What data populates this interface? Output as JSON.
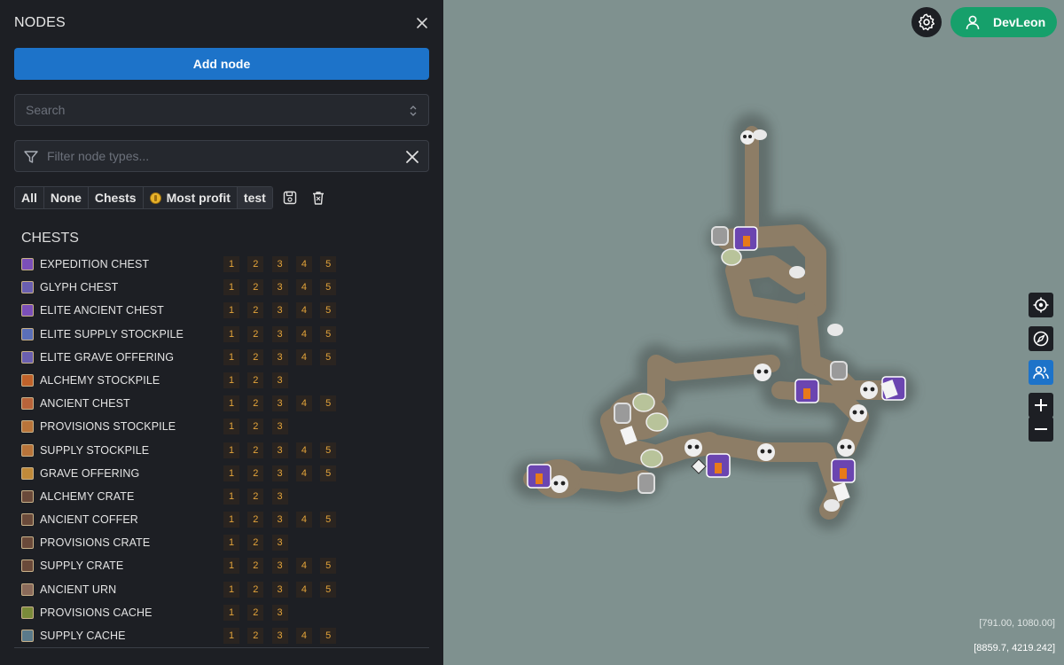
{
  "sidebar": {
    "title": "NODES",
    "add_button": "Add node",
    "search_placeholder": "Search",
    "filter_placeholder": "Filter node types...",
    "presets": [
      {
        "label": "All"
      },
      {
        "label": "None"
      },
      {
        "label": "Chests"
      },
      {
        "label": "Most profit",
        "icon": "coin-icon"
      },
      {
        "label": "test"
      }
    ],
    "tool_icons": [
      "save-preset-icon",
      "delete-preset-icon"
    ],
    "section_title": "CHESTS",
    "items": [
      {
        "label": "EXPEDITION CHEST",
        "tiers": [
          "1",
          "2",
          "3",
          "4",
          "5"
        ],
        "color": "#7b4fb8"
      },
      {
        "label": "GLYPH CHEST",
        "tiers": [
          "1",
          "2",
          "3",
          "4",
          "5"
        ],
        "color": "#6a5fb0"
      },
      {
        "label": "ELITE ANCIENT CHEST",
        "tiers": [
          "1",
          "2",
          "3",
          "4",
          "5"
        ],
        "color": "#7b4fb8"
      },
      {
        "label": "ELITE SUPPLY STOCKPILE",
        "tiers": [
          "1",
          "2",
          "3",
          "4",
          "5"
        ],
        "color": "#5a6fb8"
      },
      {
        "label": "ELITE GRAVE OFFERING",
        "tiers": [
          "1",
          "2",
          "3",
          "4",
          "5"
        ],
        "color": "#6a5fb0"
      },
      {
        "label": "ALCHEMY STOCKPILE",
        "tiers": [
          "1",
          "2",
          "3"
        ],
        "color": "#c0622a"
      },
      {
        "label": "ANCIENT CHEST",
        "tiers": [
          "1",
          "2",
          "3",
          "4",
          "5"
        ],
        "color": "#b8643a"
      },
      {
        "label": "PROVISIONS STOCKPILE",
        "tiers": [
          "1",
          "2",
          "3"
        ],
        "color": "#b8743a"
      },
      {
        "label": "SUPPLY STOCKPILE",
        "tiers": [
          "1",
          "2",
          "3",
          "4",
          "5"
        ],
        "color": "#b8743a"
      },
      {
        "label": "GRAVE OFFERING",
        "tiers": [
          "1",
          "2",
          "3",
          "4",
          "5"
        ],
        "color": "#c08a3a"
      },
      {
        "label": "ALCHEMY CRATE",
        "tiers": [
          "1",
          "2",
          "3"
        ],
        "color": "#6a4a3a"
      },
      {
        "label": "ANCIENT COFFER",
        "tiers": [
          "1",
          "2",
          "3",
          "4",
          "5"
        ],
        "color": "#6a4a3a"
      },
      {
        "label": "PROVISIONS CRATE",
        "tiers": [
          "1",
          "2",
          "3"
        ],
        "color": "#6a4a3a"
      },
      {
        "label": "SUPPLY CRATE",
        "tiers": [
          "1",
          "2",
          "3",
          "4",
          "5"
        ],
        "color": "#6a4a3a"
      },
      {
        "label": "ANCIENT URN",
        "tiers": [
          "1",
          "2",
          "3",
          "4",
          "5"
        ],
        "color": "#8a6a5a"
      },
      {
        "label": "PROVISIONS CACHE",
        "tiers": [
          "1",
          "2",
          "3"
        ],
        "color": "#7a8a3a"
      },
      {
        "label": "SUPPLY CACHE",
        "tiers": [
          "1",
          "2",
          "3",
          "4",
          "5"
        ],
        "color": "#5a7a8a"
      }
    ]
  },
  "map": {
    "user_name": "DevLeon",
    "map_controls": [
      "locate-icon",
      "compass-icon",
      "group-icon",
      "zoom-in-icon",
      "zoom-out-icon"
    ],
    "coords_primary": "[791.00, 1080.00]",
    "coords_secondary": "[8859.7, 4219.242]"
  },
  "colors": {
    "accent_blue": "#1d73c9",
    "user_green": "#16a06b",
    "tier_text": "#e4a43a",
    "sidebar_bg": "#1d1f24",
    "map_bg": "#7f918f",
    "dungeon_floor": "#8d7d66"
  }
}
